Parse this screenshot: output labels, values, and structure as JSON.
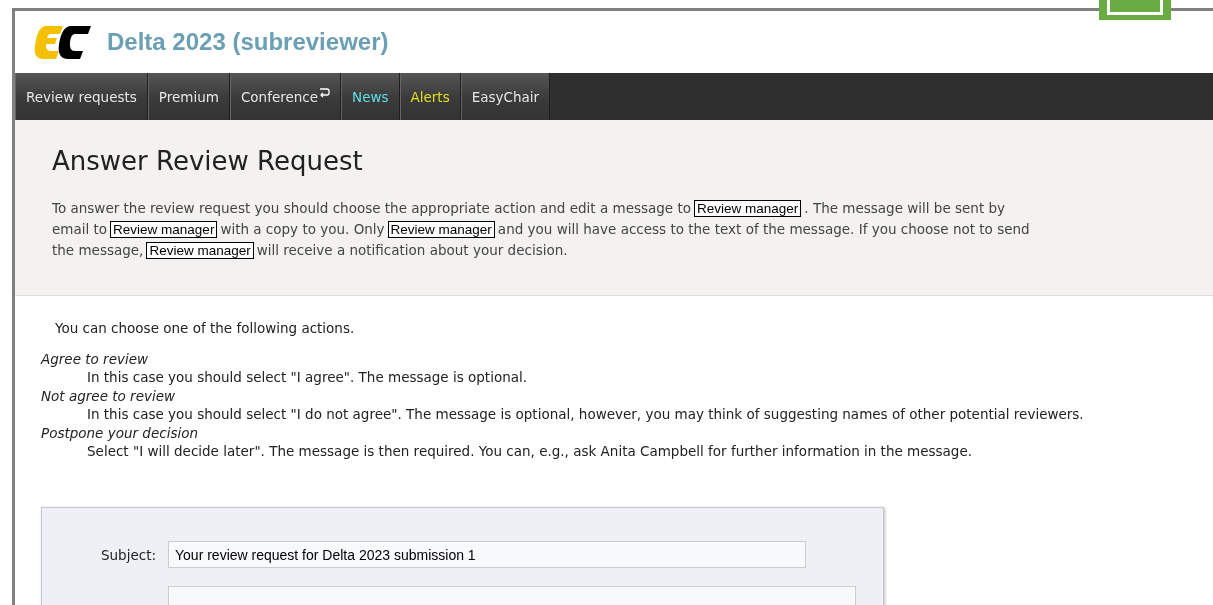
{
  "header": {
    "title": "Delta 2023 (subreviewer)"
  },
  "nav": [
    {
      "label": "Review requests",
      "kind": "plain",
      "icon": false
    },
    {
      "label": "Premium",
      "kind": "plain",
      "icon": false
    },
    {
      "label": "Conference",
      "kind": "plain",
      "icon": true
    },
    {
      "label": "News",
      "kind": "news",
      "icon": false
    },
    {
      "label": "Alerts",
      "kind": "alerts",
      "icon": false
    },
    {
      "label": "EasyChair",
      "kind": "plain",
      "icon": false
    }
  ],
  "intro": {
    "heading": "Answer Review Request",
    "paragraph": [
      {
        "kind": "text",
        "text": "To answer the review request you should choose the appropriate action and edit a message to"
      },
      {
        "kind": "tag",
        "text": "Review manager"
      },
      {
        "kind": "text",
        "text": ". The message will be sent by email to"
      },
      {
        "kind": "tag",
        "text": "Review manager"
      },
      {
        "kind": "text",
        "text": "with a copy to you. Only"
      },
      {
        "kind": "tag",
        "text": "Review manager"
      },
      {
        "kind": "text",
        "text": "and you will have access to the text of the message. If you choose not to send the message,"
      },
      {
        "kind": "tag",
        "text": "Review manager"
      },
      {
        "kind": "text",
        "text": "will receive a notification about your decision."
      }
    ]
  },
  "actions": {
    "lead": "You can choose one of the following actions.",
    "items": [
      {
        "term": "Agree to review",
        "description": "In this case you should select \"I agree\". The message is optional."
      },
      {
        "term": "Not agree to review",
        "description": "In this case you should select \"I do not agree\". The message is optional, however, you may think of suggesting names of other potential reviewers."
      },
      {
        "term": "Postpone your decision",
        "description": "Select \"I will decide later\". The message is then required. You can, e.g., ask Anita Campbell for further information in the message."
      }
    ]
  },
  "form": {
    "subject_label": "Subject:",
    "subject_value": "Your review request for Delta 2023 submission 1"
  }
}
